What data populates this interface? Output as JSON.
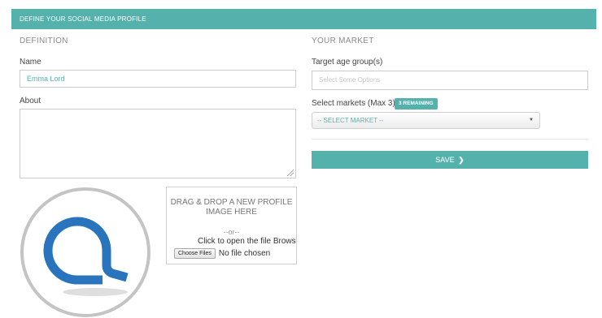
{
  "header": {
    "title": "DEFINE YOUR SOCIAL MEDIA PROFILE"
  },
  "definition": {
    "section_title": "DEFINITION",
    "name_label": "Name",
    "name_value": "Emma Lord",
    "about_label": "About",
    "about_value": ""
  },
  "market": {
    "section_title": "YOUR MARKET",
    "age_label": "Target age group(s)",
    "age_placeholder": "Select Some Options",
    "markets_label": "Select markets (Max 3)",
    "remaining_badge": "3 REMAINING",
    "market_select_value": "-- SELECT MARKET --",
    "save_label": "SAVE"
  },
  "upload": {
    "dropzone_title": "DRAG & DROP A NEW PROFILE IMAGE HERE",
    "or_text": "--or--",
    "click_text": "Click to open the file Browser",
    "choose_button": "Choose Files",
    "no_file_text": "No file chosen"
  },
  "colors": {
    "accent": "#55b1ab",
    "logo_blue": "#2a74bd",
    "logo_ring": "#c4c4c4"
  },
  "icons": {
    "save": "chevron-right-icon",
    "select": "caret-down-icon",
    "logo": "q-logo-icon"
  }
}
